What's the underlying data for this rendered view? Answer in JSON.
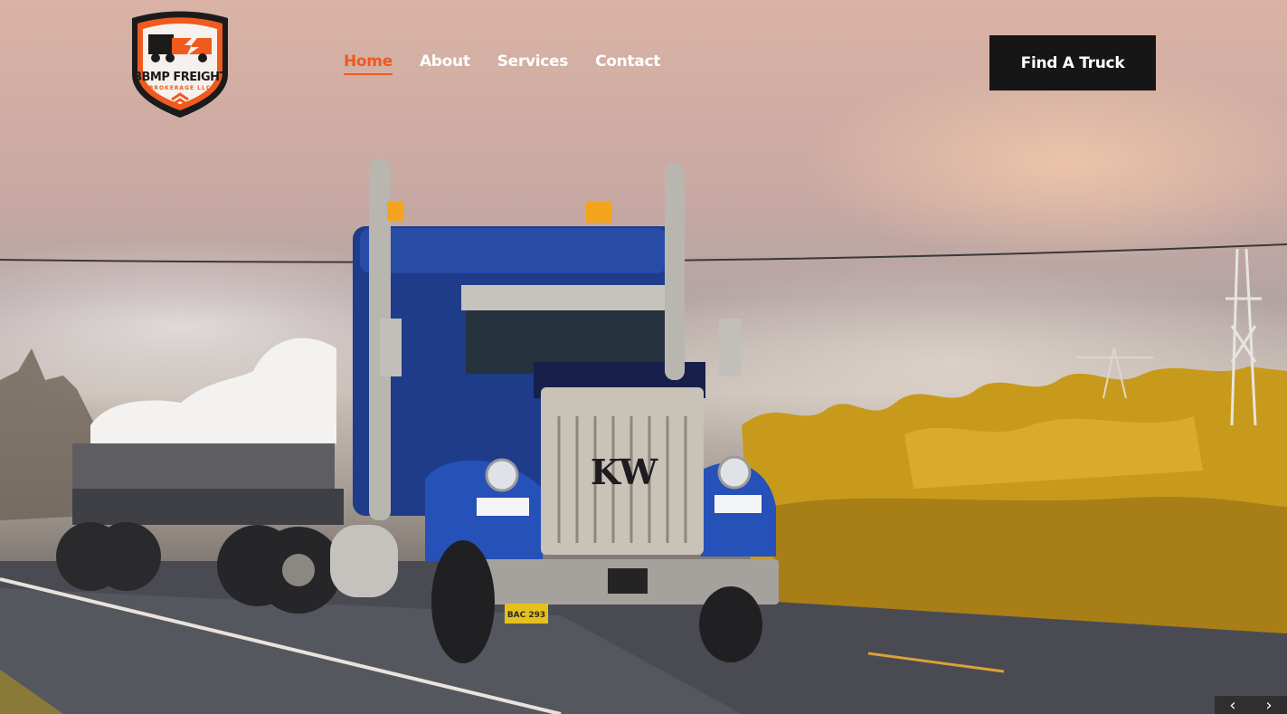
{
  "brand": {
    "name": "BBMP FREIGHT",
    "tagline": "BROKERAGE LLC",
    "colors": {
      "primary": "#ef5a1f",
      "dark": "#1b1b1b"
    }
  },
  "nav": {
    "items": [
      {
        "label": "Home",
        "active": true
      },
      {
        "label": "About",
        "active": false
      },
      {
        "label": "Services",
        "active": false
      },
      {
        "label": "Contact",
        "active": false
      }
    ]
  },
  "cta": {
    "label": "Find A Truck"
  },
  "hero": {
    "truck_grille_badge": "KW",
    "license_plate": "BAC 293",
    "slider": {
      "prev_icon": "chevron-left-icon",
      "next_icon": "chevron-right-icon",
      "prev_glyph": "‹",
      "next_glyph": "›"
    }
  }
}
